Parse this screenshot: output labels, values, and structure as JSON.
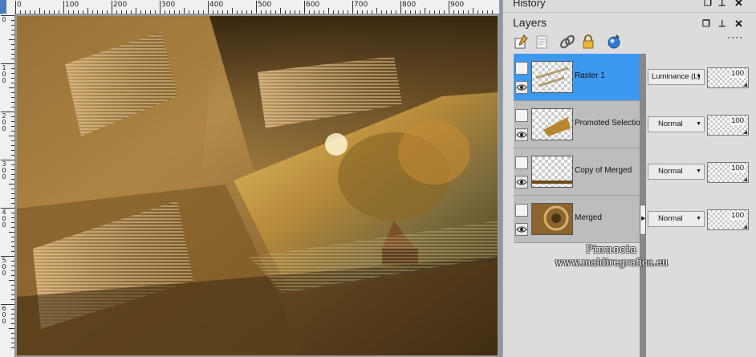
{
  "ruler": {
    "labels": [
      "0",
      "100",
      "200",
      "300",
      "400",
      "500",
      "600",
      "700",
      "800",
      "900"
    ],
    "vertical_labels": [
      "0",
      "1\n0\n0",
      "2\n0\n0",
      "3\n0\n0",
      "4\n0\n0",
      "5\n0\n0",
      "6\n0\n0"
    ]
  },
  "history_panel": {
    "title": "History"
  },
  "layers_panel": {
    "title": "Layers",
    "layers": [
      {
        "name": "Raster 1",
        "blend_mode": "Luminance (L)",
        "opacity": "100",
        "selected": true
      },
      {
        "name": "Promoted Selection",
        "blend_mode": "Normal",
        "opacity": "100",
        "selected": false
      },
      {
        "name": "Copy of Merged",
        "blend_mode": "Normal",
        "opacity": "100",
        "selected": false
      },
      {
        "name": "Merged",
        "blend_mode": "Normal",
        "opacity": "100",
        "selected": false
      }
    ]
  },
  "toolbar_icons": [
    "new-layer-icon",
    "properties-icon",
    "link-icon",
    "lock-icon",
    "mask-icon"
  ],
  "watermark": {
    "name": "Pinuccia",
    "url": "www.maldiregrafica.eu"
  },
  "colors": {
    "selected_row": "#3d98ef",
    "canvas_tone": "#9a7333"
  }
}
